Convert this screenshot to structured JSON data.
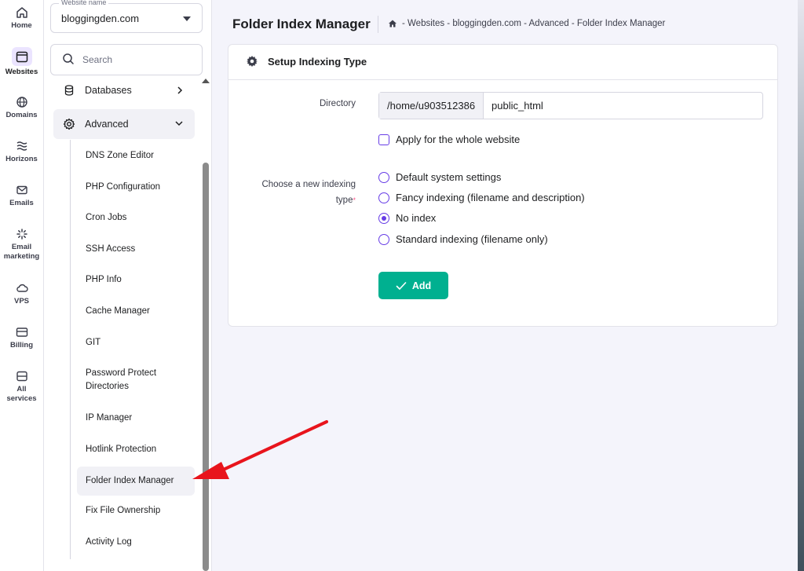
{
  "rail": {
    "items": [
      {
        "label": "Home",
        "icon": "home-icon"
      },
      {
        "label": "Websites",
        "icon": "browser-icon",
        "active": true
      },
      {
        "label": "Domains",
        "icon": "globe-icon"
      },
      {
        "label": "Horizons",
        "icon": "waves-icon"
      },
      {
        "label": "Emails",
        "icon": "mail-icon"
      },
      {
        "label": "Email marketing",
        "icon": "sparkle-icon"
      },
      {
        "label": "VPS",
        "icon": "cloud-icon"
      },
      {
        "label": "Billing",
        "icon": "card-icon"
      },
      {
        "label": "All services",
        "icon": "server-icon"
      }
    ]
  },
  "sidebar": {
    "website_label": "Website name",
    "website_value": "bloggingden.com",
    "search_placeholder": "Search",
    "nav": [
      {
        "label": "Databases",
        "icon": "database-icon",
        "expanded": false
      },
      {
        "label": "Advanced",
        "icon": "gear-icon",
        "expanded": true
      }
    ],
    "sub_items": [
      "DNS Zone Editor",
      "PHP Configuration",
      "Cron Jobs",
      "SSH Access",
      "PHP Info",
      "Cache Manager",
      "GIT",
      "Password Protect Directories",
      "IP Manager",
      "Hotlink Protection",
      "Folder Index Manager",
      "Fix File Ownership",
      "Activity Log"
    ],
    "active_sub_item": "Folder Index Manager"
  },
  "header": {
    "title": "Folder Index Manager",
    "breadcrumb": "- Websites - bloggingden.com - Advanced - Folder Index Manager"
  },
  "card": {
    "title": "Setup Indexing Type",
    "directory_label": "Directory",
    "directory_prefix": "/home/u903512386",
    "directory_value": "public_html",
    "apply_label": "Apply for the whole website",
    "indexing_label_line1": "Choose a new indexing",
    "indexing_label_line2": "type",
    "indexing_options": [
      {
        "label": "Default system settings",
        "selected": false
      },
      {
        "label": "Fancy indexing (filename and description)",
        "selected": false
      },
      {
        "label": "No index",
        "selected": true
      },
      {
        "label": "Standard indexing (filename only)",
        "selected": false
      }
    ],
    "add_label": "Add"
  },
  "colors": {
    "accent": "#673de6",
    "button": "#00b090",
    "arrow": "#e8141c"
  }
}
